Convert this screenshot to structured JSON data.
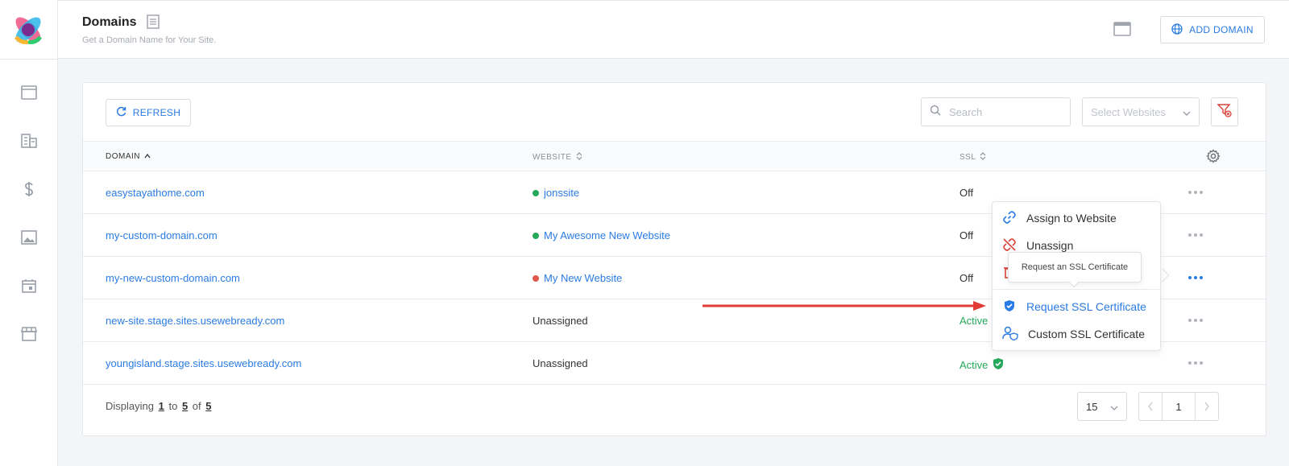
{
  "header": {
    "title": "Domains",
    "subtitle": "Get a Domain Name for Your Site.",
    "add_domain_label": "ADD DOMAIN"
  },
  "sidebar": {
    "items": [
      {
        "icon": "window-icon"
      },
      {
        "icon": "building-icon"
      },
      {
        "icon": "dollar-icon"
      },
      {
        "icon": "image-icon"
      },
      {
        "icon": "calendar-icon"
      },
      {
        "icon": "store-icon"
      }
    ]
  },
  "toolbar": {
    "refresh_label": "REFRESH",
    "search_placeholder": "Search",
    "select_websites_placeholder": "Select Websites"
  },
  "table": {
    "columns": [
      "DOMAIN",
      "WEBSITE",
      "SSL"
    ],
    "rows": [
      {
        "domain": "easystayathome.com",
        "website": "jonssite",
        "website_status": "green",
        "ssl": "Off"
      },
      {
        "domain": "my-custom-domain.com",
        "website": "My Awesome New Website",
        "website_status": "green",
        "ssl": "Off"
      },
      {
        "domain": "my-new-custom-domain.com",
        "website": "My New Website",
        "website_status": "red",
        "ssl": "Off"
      },
      {
        "domain": "new-site.stage.sites.usewebready.com",
        "website": "Unassigned",
        "website_status": "none",
        "ssl": "Active"
      },
      {
        "domain": "youngisland.stage.sites.usewebready.com",
        "website": "Unassigned",
        "website_status": "none",
        "ssl": "Active"
      }
    ]
  },
  "footer": {
    "displaying": "Displaying",
    "from": "1",
    "to_word": "to",
    "to": "5",
    "of_word": "of",
    "total": "5",
    "per_page": "15",
    "page": "1"
  },
  "context_menu": {
    "items": [
      {
        "label": "Assign to Website",
        "icon": "link-icon"
      },
      {
        "label": "Unassign",
        "icon": "unlink-icon"
      },
      {
        "label": "Request SSL Certificate",
        "icon": "shield-check-icon"
      },
      {
        "label": "Custom SSL Certificate",
        "icon": "user-shield-icon"
      }
    ],
    "tooltip": "Request an SSL Certificate"
  },
  "colors": {
    "accent": "#2a7be4",
    "active_green": "#24a85a",
    "status_red": "#e0594b",
    "arrow_red": "#e23b35"
  }
}
